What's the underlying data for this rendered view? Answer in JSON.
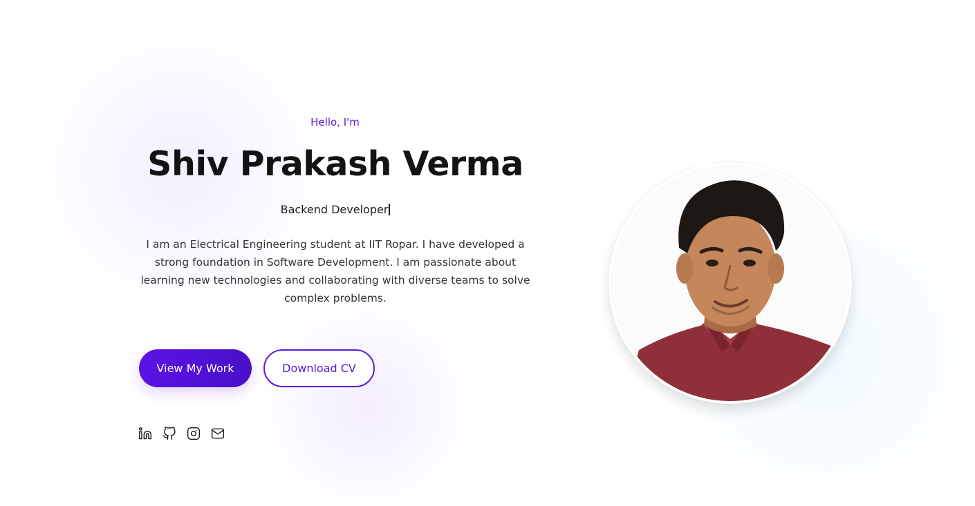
{
  "hero": {
    "greeting": "Hello, I'm",
    "name": "Shiv Prakash Verma",
    "role": "Backend Developer",
    "bio": "I am an Electrical Engineering student at IIT Ropar. I have developed a strong foundation in Software Development. I am passionate about learning new technologies and collaborating with diverse teams to solve complex problems."
  },
  "actions": {
    "primary_label": "View My Work",
    "secondary_label": "Download CV"
  },
  "socials": [
    {
      "icon": "linkedin-icon"
    },
    {
      "icon": "github-icon"
    },
    {
      "icon": "instagram-icon"
    },
    {
      "icon": "mail-icon"
    }
  ],
  "colors": {
    "accent": "#5a12e6",
    "heading": "#131313",
    "text": "#333333"
  }
}
